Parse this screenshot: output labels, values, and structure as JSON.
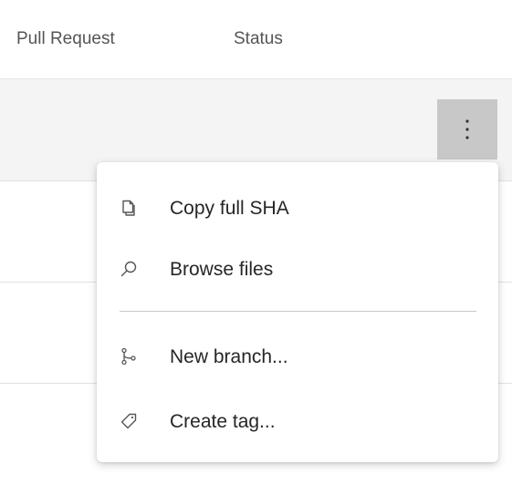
{
  "table": {
    "columns": {
      "pull_request": "Pull Request",
      "status": "Status"
    }
  },
  "row_actions": {
    "more_icon": "more-vertical-icon"
  },
  "context_menu": {
    "items": [
      {
        "label": "Copy full SHA",
        "icon": "copy-icon"
      },
      {
        "label": "Browse files",
        "icon": "search-icon"
      },
      {
        "label": "New branch...",
        "icon": "branch-icon"
      },
      {
        "label": "Create tag...",
        "icon": "tag-icon"
      }
    ]
  },
  "colors": {
    "selected_row": "#f4f4f4",
    "more_button_active": "#c8c8c8",
    "menu_text": "#262626",
    "header_text": "#555555"
  }
}
